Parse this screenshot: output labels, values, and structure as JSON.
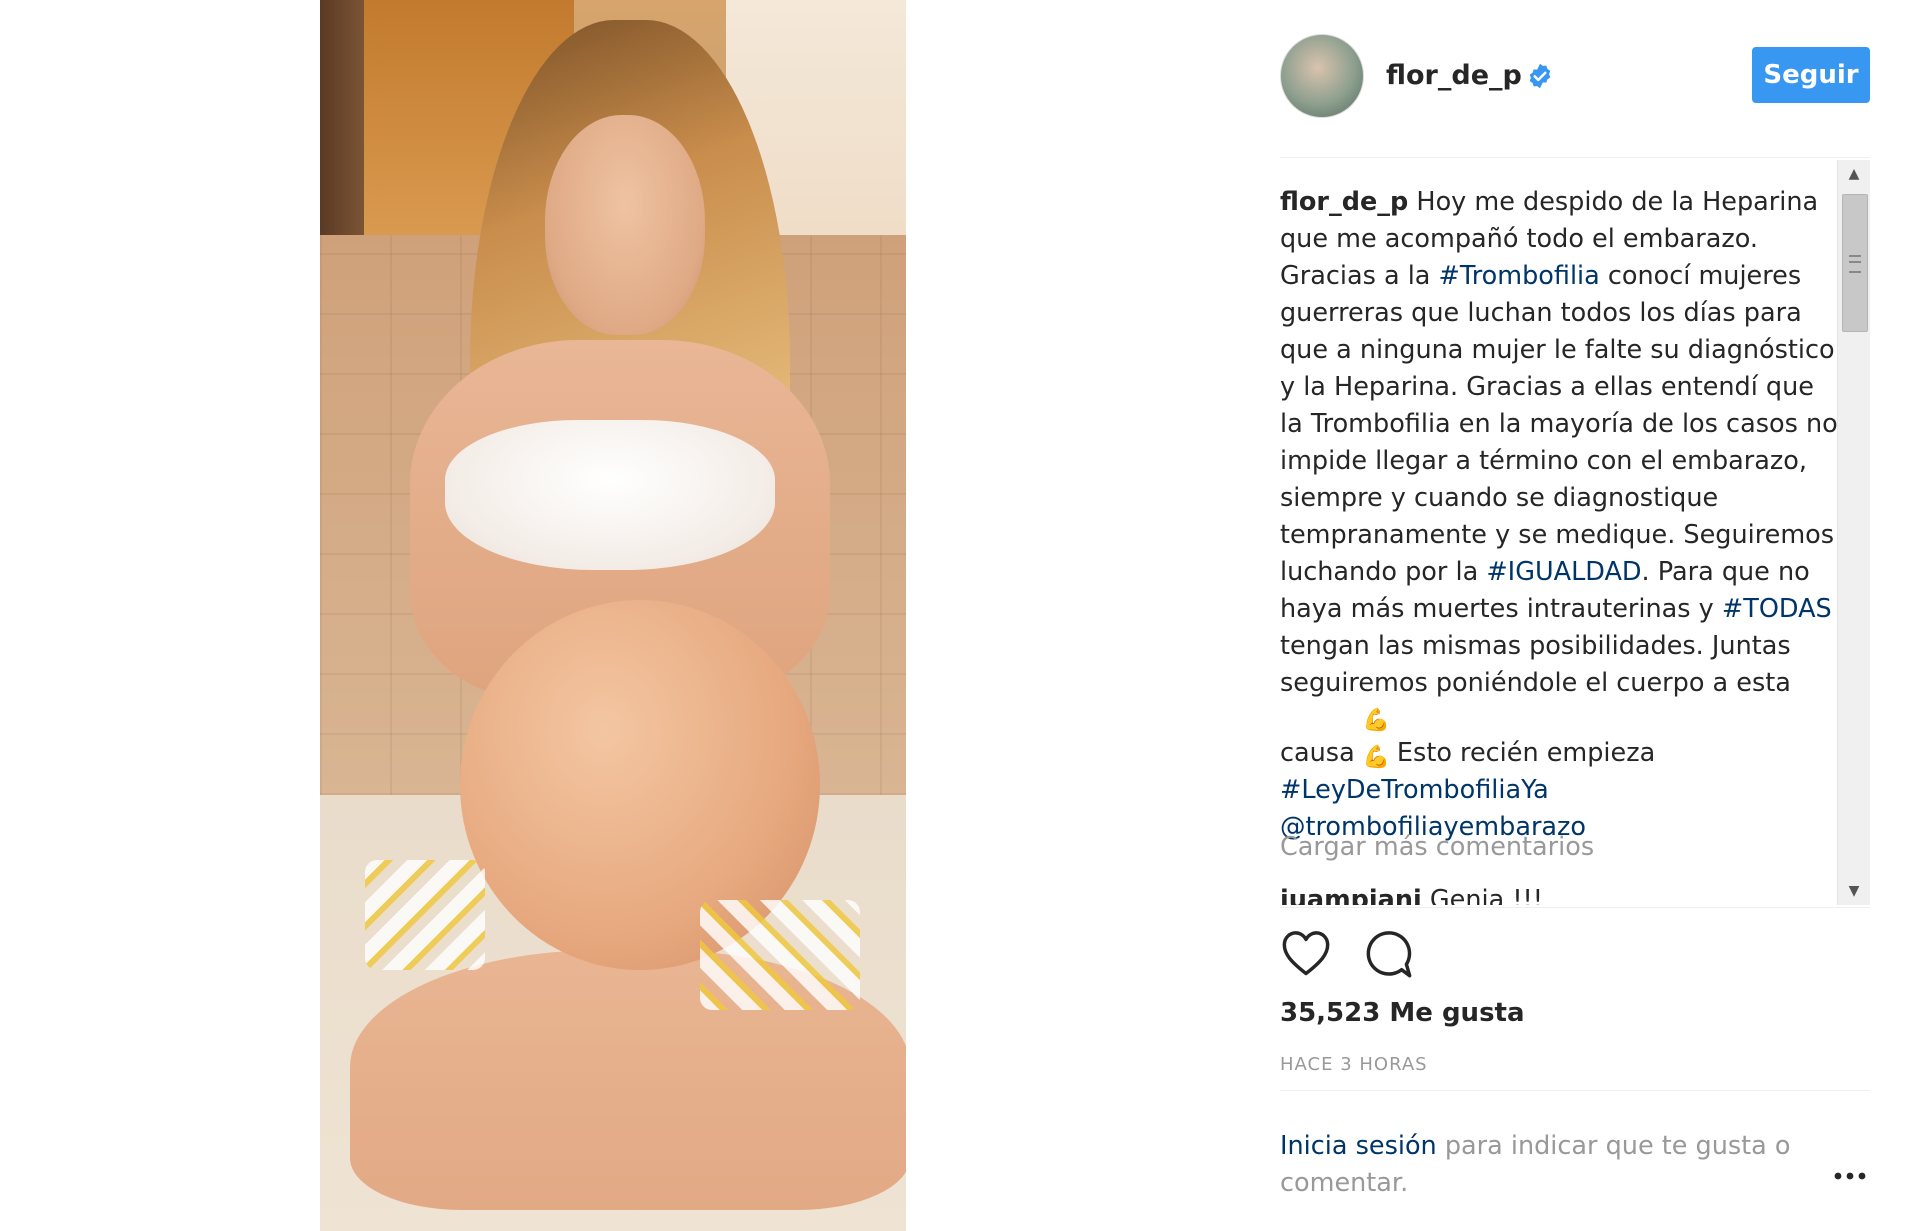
{
  "post": {
    "username": "flor_de_p",
    "follow_label": "Seguir",
    "caption": {
      "username": "flor_de_p",
      "p1": " Hoy me despido de la Heparina que me acompañó todo el embarazo. Gracias a la ",
      "tag1": "#Trombofilia",
      "p2": " conocí mujeres guerreras que luchan todos los días para que a ninguna mujer le falte su diagnóstico y la Heparina. Gracias a ellas entendí que la Trombofilia en la mayoría de los casos no impide llegar a término con el embarazo, siempre y cuando se diagnostique tempranamente y se medique. Seguiremos luchando por la ",
      "tag2": "#IGUALDAD",
      "p3": ". Para que no haya más muertes intrauterinas y ",
      "tag3": "#TODAS",
      "p4": " tengan las mismas posibilidades. Juntas seguiremos poniéndole el cuerpo a esta causa ",
      "emoji": "💪💪",
      "p5": " Esto recién empieza",
      "tag4": "#LeyDeTrombofiliaYa",
      "mention": "@trombofiliayembarazo"
    },
    "load_more_label": "Cargar más comentarios",
    "next_comment": {
      "username": "juampiani",
      "text": " Genia !!!"
    },
    "likes_label": "35,523 Me gusta",
    "time_label": "HACE 3 HORAS",
    "login": {
      "link_label": "Inicia sesión",
      "rest": " para indicar que te gusta o comentar."
    }
  },
  "icons": {
    "verified": "verified-badge-icon",
    "like": "heart-icon",
    "comment": "comment-bubble-icon",
    "more": "more-options-icon"
  },
  "colors": {
    "accent": "#3897f0",
    "link": "#003569",
    "muted": "#999999",
    "text": "#262626"
  }
}
